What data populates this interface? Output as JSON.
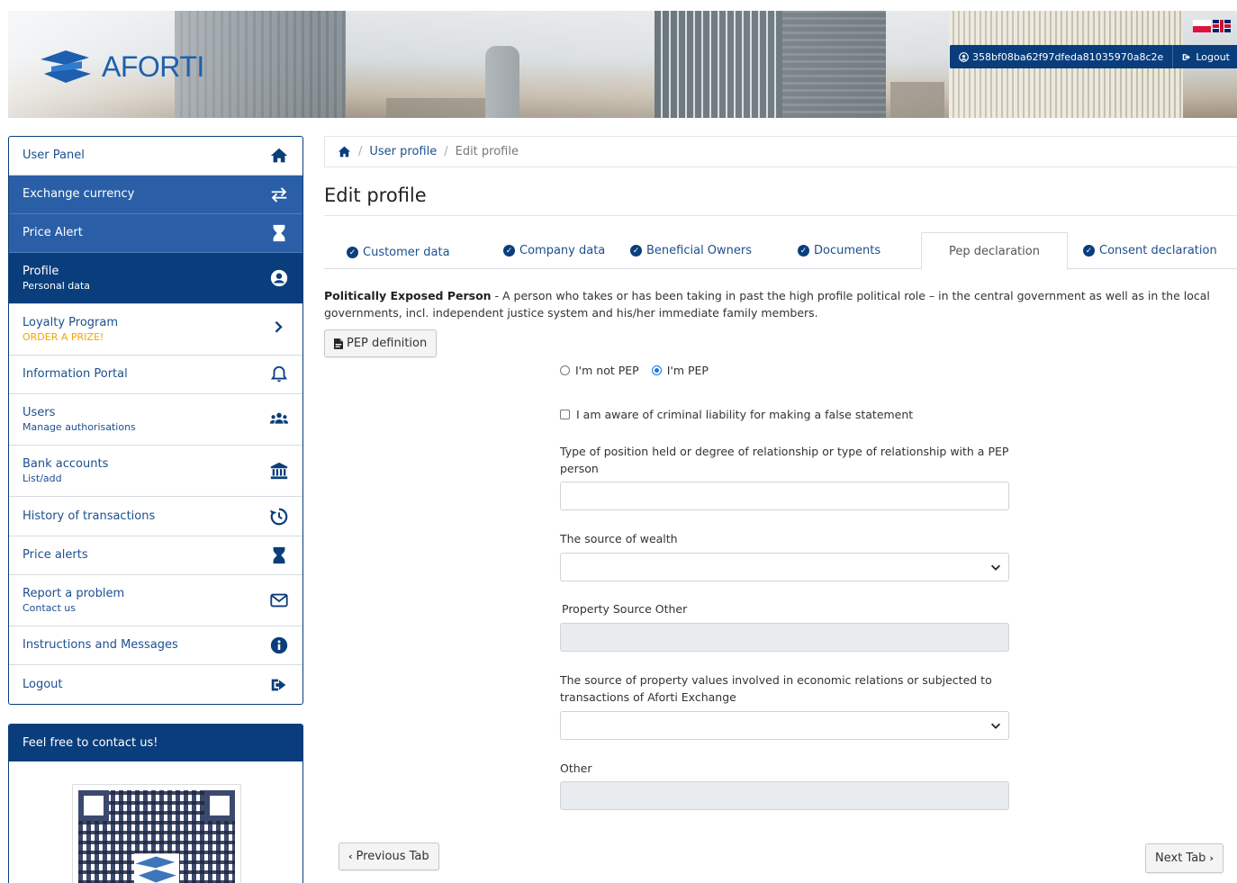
{
  "header": {
    "logo_text": "AFORTI",
    "user_id": "358bf08ba62f97dfeda81035970a8c2e",
    "logout_label": "Logout"
  },
  "sidebar": {
    "items": [
      {
        "label": "User Panel",
        "sub": "",
        "icon": "home-icon"
      },
      {
        "label": "Exchange currency",
        "sub": "",
        "icon": "exchange-icon"
      },
      {
        "label": "Price Alert",
        "sub": "",
        "icon": "hourglass-icon"
      },
      {
        "label": "Profile",
        "sub": "Personal data",
        "icon": "user-circle-icon"
      },
      {
        "label": "Loyalty Program",
        "sub": "ORDER A PRIZE!",
        "icon": "chevron-right-icon"
      },
      {
        "label": "Information Portal",
        "sub": "",
        "icon": "bell-icon"
      },
      {
        "label": "Users",
        "sub": "Manage authorisations",
        "icon": "users-icon"
      },
      {
        "label": "Bank accounts",
        "sub": "List/add",
        "icon": "bank-icon"
      },
      {
        "label": "History of transactions",
        "sub": "",
        "icon": "history-icon"
      },
      {
        "label": "Price alerts",
        "sub": "",
        "icon": "hourglass-icon"
      },
      {
        "label": "Report a problem",
        "sub": "Contact us",
        "icon": "envelope-icon"
      },
      {
        "label": "Instructions and Messages",
        "sub": "",
        "icon": "info-icon"
      },
      {
        "label": "Logout",
        "sub": "",
        "icon": "sign-out-icon"
      }
    ],
    "contact_title": "Feel free to contact us!"
  },
  "breadcrumb": {
    "user_profile": "User profile",
    "edit_profile": "Edit profile"
  },
  "page_title": "Edit profile",
  "tabs": [
    {
      "label": "Customer data",
      "checked": true
    },
    {
      "label": "Company data",
      "checked": true
    },
    {
      "label": "Beneficial Owners",
      "checked": true
    },
    {
      "label": "Documents",
      "checked": true
    },
    {
      "label": "Pep declaration",
      "checked": false,
      "active": true
    },
    {
      "label": "Consent declaration",
      "checked": true
    }
  ],
  "pep": {
    "term": "Politically Exposed Person",
    "description": " - A person who takes or has been taking in past the high profile political role – in the central government as well as in the local governments, incl. independent justice system and his/her immediate family members.",
    "definition_button": "PEP definition"
  },
  "form": {
    "radio_not_pep": "I'm not PEP",
    "radio_pep": "I'm PEP",
    "selected": "I'm PEP",
    "checkbox_label": "I am aware of criminal liability for making a false statement",
    "position_label": "Type of position held or degree of relationship or type of relationship with a PEP person",
    "position_value": "",
    "wealth_label": "The source of wealth",
    "wealth_value": "",
    "property_other_label": "Property Source Other",
    "property_source_label": "The source of property values involved in economic relations or subjected to transactions of Aforti Exchange",
    "property_source_value": "",
    "other_label": "Other"
  },
  "nav_buttons": {
    "previous": "Previous Tab",
    "next": "Next Tab"
  },
  "colors": {
    "primary": "#0a3d7c",
    "active_light": "#2a5fa8",
    "link": "#1d4f8f",
    "gold": "#f0a500"
  }
}
